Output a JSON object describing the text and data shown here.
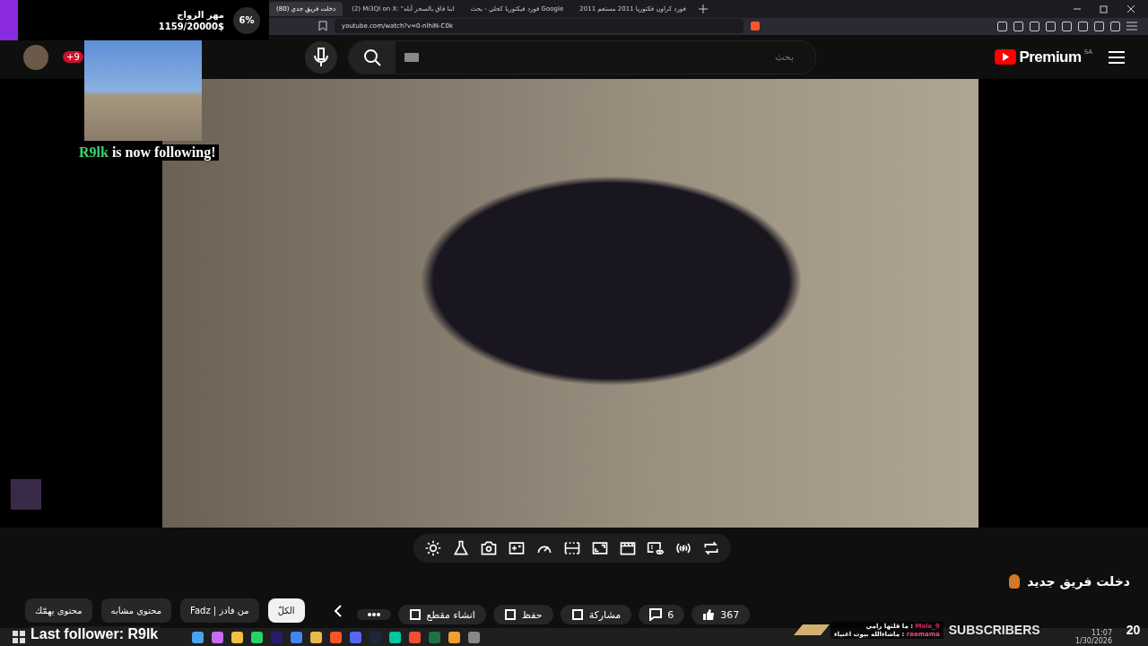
{
  "browser": {
    "tabs": [
      {
        "title": "2011 فورد كراون فكتوريا 2011 مستعم",
        "selected": false
      },
      {
        "title": "فورد فيكتوريا كحلي - بحث Google",
        "selected": false
      },
      {
        "title": "(2) Mi3QI on X: \"ابنا فاق بالسحر أبله",
        "selected": false
      },
      {
        "title": "(80) دخلت فريق جدي",
        "selected": true
      }
    ],
    "url": "youtube.com/watch?v=0-nlhiN-C0k"
  },
  "donation_goal": {
    "title": "مهر الزواج",
    "amount": "1159/20000$",
    "percent": "6%"
  },
  "header": {
    "notification_count": "+9",
    "search_placeholder": "بحث",
    "logo": "Premium",
    "region": "SA"
  },
  "follow_alert": {
    "name": "R9lk",
    "message": "is now following!"
  },
  "video": {
    "title": "دخلت فريق جديد",
    "likes": "367",
    "comments": "6",
    "actions": [
      "مشاركة",
      "حفظ",
      "انشاء مقطع"
    ]
  },
  "chips": [
    {
      "label": "الكلّ",
      "selected": true
    },
    {
      "label": "من فادز | Fadz",
      "selected": false
    },
    {
      "label": "محتوى مشابه",
      "selected": false
    },
    {
      "label": "محتوى يهمّك",
      "selected": false
    }
  ],
  "stream_overlay": {
    "last_follower": "Last follower: R9lk",
    "subscribers_label": "SUBSCRIBERS",
    "subscribers_count": "20",
    "chat": [
      {
        "user": "Mole_9",
        "message": ": ما قلتها رامي",
        "color": "#e0245e"
      },
      {
        "user": "reemama",
        "message": ": ماشاءالله بيوت اغنياء",
        "color": "#e8508a"
      }
    ]
  },
  "taskbar": {
    "time": "11:07",
    "date": "1/30/2026"
  }
}
